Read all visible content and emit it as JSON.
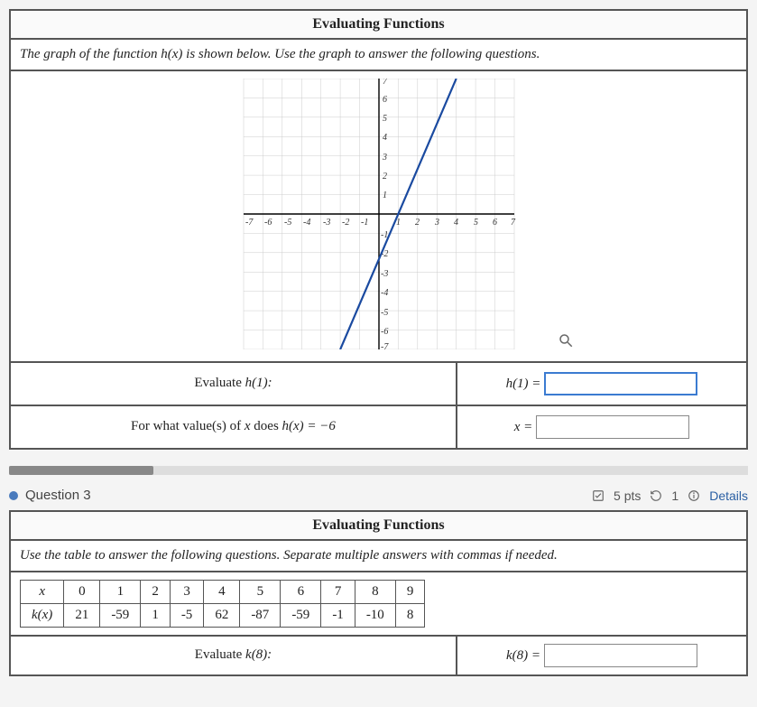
{
  "q2": {
    "title": "Evaluating Functions",
    "instruction_pre": "The graph of the function ",
    "instruction_fn": "h(x)",
    "instruction_post": " is shown below. Use the graph to answer the following questions.",
    "row1_prompt_pre": "Evaluate ",
    "row1_prompt_fn": "h(1):",
    "row1_answer_label": "h(1) =",
    "row1_value": "",
    "row2_prompt_pre": "For what value(s) of ",
    "row2_prompt_var": "x",
    "row2_prompt_mid": " does ",
    "row2_prompt_fn": "h(x) = −6",
    "row2_answer_label": "x =",
    "row2_value": ""
  },
  "chart_data": {
    "type": "line",
    "title": "",
    "xlabel": "",
    "ylabel": "",
    "xlim": [
      -7,
      7
    ],
    "ylim": [
      -7,
      7
    ],
    "xticks": [
      -7,
      -6,
      -5,
      -4,
      -3,
      -2,
      -1,
      1,
      2,
      3,
      4,
      5,
      6,
      7
    ],
    "yticks": [
      -7,
      -6,
      -5,
      -4,
      -3,
      -2,
      -1,
      1,
      2,
      3,
      4,
      5,
      6,
      7
    ],
    "series": [
      {
        "name": "h(x)",
        "x": [
          -2,
          4
        ],
        "y": [
          -7,
          7
        ]
      }
    ],
    "grid": true
  },
  "q3": {
    "header": "Question 3",
    "pts": "5 pts",
    "attempts": "1",
    "details": "Details",
    "title": "Evaluating Functions",
    "instruction": "Use the table to answer the following questions. Separate multiple answers with commas if needed.",
    "row_var": "x",
    "row_fn": "k(x)",
    "x_vals": [
      "0",
      "1",
      "2",
      "3",
      "4",
      "5",
      "6",
      "7",
      "8",
      "9"
    ],
    "k_vals": [
      "21",
      "-59",
      "1",
      "-5",
      "62",
      "-87",
      "-59",
      "-1",
      "-10",
      "8"
    ],
    "eval_prompt_pre": "Evaluate ",
    "eval_prompt_fn": "k(8):",
    "eval_answer_label": "k(8) =",
    "eval_value": ""
  },
  "icons": {
    "check": "check-square-icon",
    "reset": "reset-icon",
    "info": "info-icon",
    "magnify": "magnify-icon"
  }
}
